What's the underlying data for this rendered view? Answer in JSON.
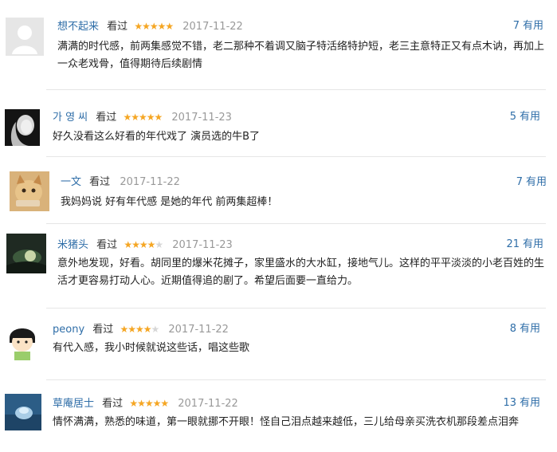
{
  "comments": [
    {
      "user": "想不起来",
      "action": "看过",
      "rating": 5,
      "date": "2017-11-22",
      "useful_count": "7",
      "useful_label": "有用",
      "text": "满满的时代感，前两集感觉不错，老二那种不着调又脑子特活络特护短，老三主意特正又有点木讷，再加上一众老戏骨，值得期待后续剧情"
    },
    {
      "user": "가 영 씨",
      "action": "看过",
      "rating": 5,
      "date": "2017-11-23",
      "useful_count": "5",
      "useful_label": "有用",
      "text": "好久没看这么好看的年代戏了 演员选的牛B了"
    },
    {
      "user": "一文",
      "action": "看过",
      "rating": 0,
      "date": "2017-11-22",
      "useful_count": "7",
      "useful_label": "有用",
      "text": "我妈妈说 好有年代感 是她的年代 前两集超棒！"
    },
    {
      "user": "米猪头",
      "action": "看过",
      "rating": 4,
      "date": "2017-11-23",
      "useful_count": "21",
      "useful_label": "有用",
      "text": "意外地发现，好看。胡同里的爆米花摊子，家里盛水的大水缸，接地气儿。这样的平平淡淡的小老百姓的生活才更容易打动人心。近期值得追的剧了。希望后面要一直给力。"
    },
    {
      "user": "peony",
      "action": "看过",
      "rating": 4,
      "date": "2017-11-22",
      "useful_count": "8",
      "useful_label": "有用",
      "text": "有代入感，我小时候就说这些话，唱这些歌"
    },
    {
      "user": "草庵居士",
      "action": "看过",
      "rating": 5,
      "date": "2017-11-22",
      "useful_count": "13",
      "useful_label": "有用",
      "text": "情怀满满，熟悉的味道，第一眼就挪不开眼！怪自己泪点越来越低，三儿给母亲买洗衣机那段差点泪奔"
    }
  ],
  "colors": {
    "link": "#2f6ea8",
    "star": "#f5a623",
    "date": "#999999"
  },
  "icons": [
    "avatar-default-icon",
    "star-icon"
  ]
}
